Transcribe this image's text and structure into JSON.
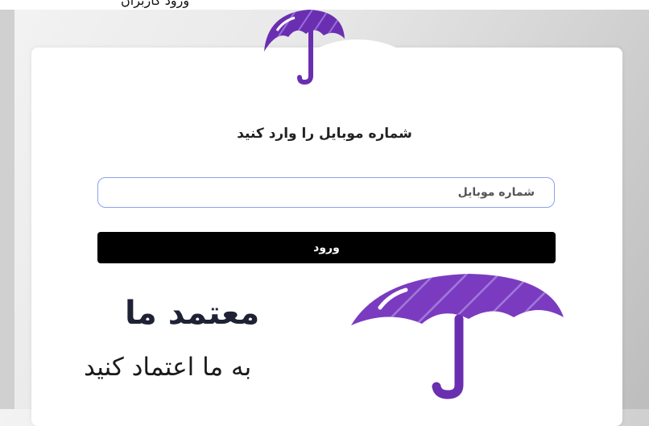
{
  "page": {
    "top_text": "ورود کاربران"
  },
  "login": {
    "heading": "شماره موبایل را وارد کنید",
    "phone_placeholder": "شماره موبایل",
    "phone_value": "",
    "submit_label": "ورود"
  },
  "brand": {
    "name": "معتمد ما",
    "tagline": "به ما اعتماد کنید",
    "logo_icon": "umbrella-icon",
    "accent_color": "#6a2fb0",
    "accent_light": "#8a4fd0"
  }
}
